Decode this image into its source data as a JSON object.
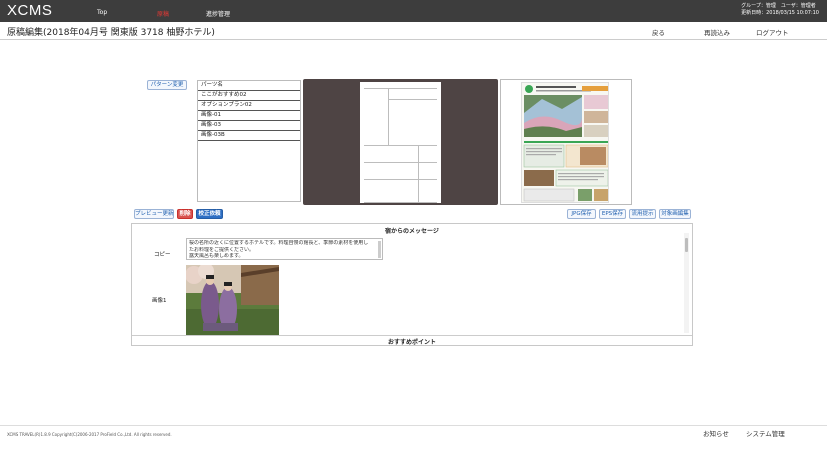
{
  "app": {
    "logo": "XCMS"
  },
  "nav": {
    "top": "Top",
    "genko": "原稿",
    "shinchoku": "進捗管理"
  },
  "user": {
    "line1": "グループ：管理　ユーザ：管理者",
    "line2": "更新日時：2018/03/15 10:07:10"
  },
  "titlebar": {
    "title": "原稿編集(2018年04月号 関東版 3718 柚野ホテル)",
    "back": "戻る",
    "reload": "再読込み",
    "logout": "ログアウト"
  },
  "pattern_button": "パターン変更",
  "parts": {
    "header": "パーツ名",
    "items": [
      "ここがおすすめ02",
      "オプションプラン02",
      "画像-01",
      "画像-03",
      "画像-03B"
    ]
  },
  "actions": {
    "preview": "プレビュー更新",
    "delete": "削除",
    "revise": "校正依頼",
    "jpg": "JPG保存",
    "eps": "EPS保存",
    "flow": "流用提示",
    "batch": "対象画編集"
  },
  "content": {
    "section1_title": "宿からのメッセージ",
    "copy_label": "コピー",
    "copy_lines": [
      "桜の名所の近くに位置するホテルです。料理自慢の館長と、季節の素材を使用し",
      "たお料理をご提供ください。",
      "露天風呂も楽しめます。"
    ],
    "image_label": "画像1",
    "section2_title": "おすすめポイント"
  },
  "footer": {
    "copyright": "XCMS TRAVEL(R)1.8.9  Copyright(C)2006-2017 ProField Co.,Ltd. All rights reserved.",
    "notice": "お知らせ",
    "sysadmin": "システム管理"
  },
  "colors": {
    "topbar": "#3d3d3d",
    "active_nav": "#e53935",
    "preview_bg": "#4e4444",
    "delete_btn": "#d9534f",
    "revise_btn": "#2e6fc4",
    "button_text": "#1f5fae"
  }
}
